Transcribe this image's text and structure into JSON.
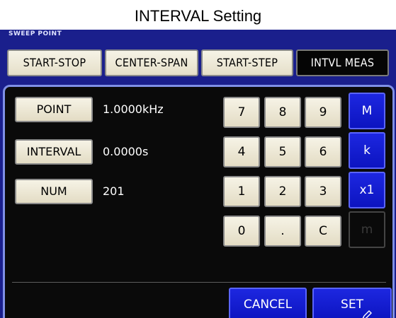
{
  "title": "INTERVAL Setting",
  "section_label": "SWEEP POINT",
  "modes": [
    {
      "label": "START-STOP",
      "active": false
    },
    {
      "label": "CENTER-SPAN",
      "active": false
    },
    {
      "label": "START-STEP",
      "active": false
    },
    {
      "label": "INTVL MEAS",
      "active": true
    }
  ],
  "params": [
    {
      "label": "POINT",
      "value": "1.0000kHz"
    },
    {
      "label": "INTERVAL",
      "value": "0.0000s"
    },
    {
      "label": "NUM",
      "value": "201"
    }
  ],
  "keypad": {
    "digits": [
      "7",
      "8",
      "9",
      "4",
      "5",
      "6",
      "1",
      "2",
      "3",
      "0",
      ".",
      "C"
    ],
    "units": [
      "M",
      "k",
      "x1",
      "m"
    ]
  },
  "actions": {
    "cancel": "CANCEL",
    "set": "SET"
  },
  "colors": {
    "screen_bg": "#1a1f8c",
    "panel_border": "#7f90e6",
    "unit_key": "#1420d8",
    "key_face": "#efeadb"
  }
}
